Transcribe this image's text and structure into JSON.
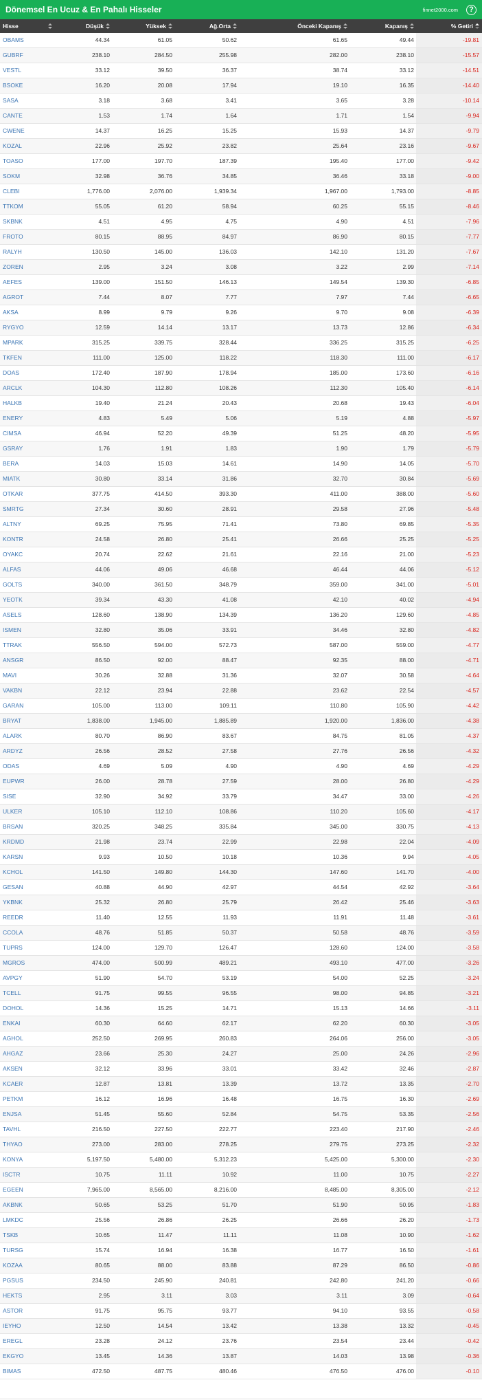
{
  "title": "Dönemsel En Ucuz & En Pahalı Hisseler",
  "site": "finnet2000.com",
  "help_label": "?",
  "columns": {
    "hisse": "Hisse",
    "dusuk": "Düşük",
    "yuksek": "Yüksek",
    "agorta": "Ağ.Orta",
    "onceki": "Önceki Kapanış",
    "kapanis": "Kapanış",
    "getiri": "% Getiri"
  },
  "rows": [
    [
      "OBAMS",
      "44.34",
      "61.05",
      "50.62",
      "61.65",
      "49.44",
      "-19.81"
    ],
    [
      "GUBRF",
      "238.10",
      "284.50",
      "255.98",
      "282.00",
      "238.10",
      "-15.57"
    ],
    [
      "VESTL",
      "33.12",
      "39.50",
      "36.37",
      "38.74",
      "33.12",
      "-14.51"
    ],
    [
      "BSOKE",
      "16.20",
      "20.08",
      "17.94",
      "19.10",
      "16.35",
      "-14.40"
    ],
    [
      "SASA",
      "3.18",
      "3.68",
      "3.41",
      "3.65",
      "3.28",
      "-10.14"
    ],
    [
      "CANTE",
      "1.53",
      "1.74",
      "1.64",
      "1.71",
      "1.54",
      "-9.94"
    ],
    [
      "CWENE",
      "14.37",
      "16.25",
      "15.25",
      "15.93",
      "14.37",
      "-9.79"
    ],
    [
      "KOZAL",
      "22.96",
      "25.92",
      "23.82",
      "25.64",
      "23.16",
      "-9.67"
    ],
    [
      "TOASO",
      "177.00",
      "197.70",
      "187.39",
      "195.40",
      "177.00",
      "-9.42"
    ],
    [
      "SOKM",
      "32.98",
      "36.76",
      "34.85",
      "36.46",
      "33.18",
      "-9.00"
    ],
    [
      "CLEBI",
      "1,776.00",
      "2,076.00",
      "1,939.34",
      "1,967.00",
      "1,793.00",
      "-8.85"
    ],
    [
      "TTKOM",
      "55.05",
      "61.20",
      "58.94",
      "60.25",
      "55.15",
      "-8.46"
    ],
    [
      "SKBNK",
      "4.51",
      "4.95",
      "4.75",
      "4.90",
      "4.51",
      "-7.96"
    ],
    [
      "FROTO",
      "80.15",
      "88.95",
      "84.97",
      "86.90",
      "80.15",
      "-7.77"
    ],
    [
      "RALYH",
      "130.50",
      "145.00",
      "136.03",
      "142.10",
      "131.20",
      "-7.67"
    ],
    [
      "ZOREN",
      "2.95",
      "3.24",
      "3.08",
      "3.22",
      "2.99",
      "-7.14"
    ],
    [
      "AEFES",
      "139.00",
      "151.50",
      "146.13",
      "149.54",
      "139.30",
      "-6.85"
    ],
    [
      "AGROT",
      "7.44",
      "8.07",
      "7.77",
      "7.97",
      "7.44",
      "-6.65"
    ],
    [
      "AKSA",
      "8.99",
      "9.79",
      "9.26",
      "9.70",
      "9.08",
      "-6.39"
    ],
    [
      "RYGYO",
      "12.59",
      "14.14",
      "13.17",
      "13.73",
      "12.86",
      "-6.34"
    ],
    [
      "MPARK",
      "315.25",
      "339.75",
      "328.44",
      "336.25",
      "315.25",
      "-6.25"
    ],
    [
      "TKFEN",
      "111.00",
      "125.00",
      "118.22",
      "118.30",
      "111.00",
      "-6.17"
    ],
    [
      "DOAS",
      "172.40",
      "187.90",
      "178.94",
      "185.00",
      "173.60",
      "-6.16"
    ],
    [
      "ARCLK",
      "104.30",
      "112.80",
      "108.26",
      "112.30",
      "105.40",
      "-6.14"
    ],
    [
      "HALKB",
      "19.40",
      "21.24",
      "20.43",
      "20.68",
      "19.43",
      "-6.04"
    ],
    [
      "ENERY",
      "4.83",
      "5.49",
      "5.06",
      "5.19",
      "4.88",
      "-5.97"
    ],
    [
      "CIMSA",
      "46.94",
      "52.20",
      "49.39",
      "51.25",
      "48.20",
      "-5.95"
    ],
    [
      "GSRAY",
      "1.76",
      "1.91",
      "1.83",
      "1.90",
      "1.79",
      "-5.79"
    ],
    [
      "BERA",
      "14.03",
      "15.03",
      "14.61",
      "14.90",
      "14.05",
      "-5.70"
    ],
    [
      "MIATK",
      "30.80",
      "33.14",
      "31.86",
      "32.70",
      "30.84",
      "-5.69"
    ],
    [
      "OTKAR",
      "377.75",
      "414.50",
      "393.30",
      "411.00",
      "388.00",
      "-5.60"
    ],
    [
      "SMRTG",
      "27.34",
      "30.60",
      "28.91",
      "29.58",
      "27.96",
      "-5.48"
    ],
    [
      "ALTNY",
      "69.25",
      "75.95",
      "71.41",
      "73.80",
      "69.85",
      "-5.35"
    ],
    [
      "KONTR",
      "24.58",
      "26.80",
      "25.41",
      "26.66",
      "25.25",
      "-5.25"
    ],
    [
      "OYAKC",
      "20.74",
      "22.62",
      "21.61",
      "22.16",
      "21.00",
      "-5.23"
    ],
    [
      "ALFAS",
      "44.06",
      "49.06",
      "46.68",
      "46.44",
      "44.06",
      "-5.12"
    ],
    [
      "GOLTS",
      "340.00",
      "361.50",
      "348.79",
      "359.00",
      "341.00",
      "-5.01"
    ],
    [
      "YEOTK",
      "39.34",
      "43.30",
      "41.08",
      "42.10",
      "40.02",
      "-4.94"
    ],
    [
      "ASELS",
      "128.60",
      "138.90",
      "134.39",
      "136.20",
      "129.60",
      "-4.85"
    ],
    [
      "ISMEN",
      "32.80",
      "35.06",
      "33.91",
      "34.46",
      "32.80",
      "-4.82"
    ],
    [
      "TTRAK",
      "556.50",
      "594.00",
      "572.73",
      "587.00",
      "559.00",
      "-4.77"
    ],
    [
      "ANSGR",
      "86.50",
      "92.00",
      "88.47",
      "92.35",
      "88.00",
      "-4.71"
    ],
    [
      "MAVI",
      "30.26",
      "32.88",
      "31.36",
      "32.07",
      "30.58",
      "-4.64"
    ],
    [
      "VAKBN",
      "22.12",
      "23.94",
      "22.88",
      "23.62",
      "22.54",
      "-4.57"
    ],
    [
      "GARAN",
      "105.00",
      "113.00",
      "109.11",
      "110.80",
      "105.90",
      "-4.42"
    ],
    [
      "BRYAT",
      "1,838.00",
      "1,945.00",
      "1,885.89",
      "1,920.00",
      "1,836.00",
      "-4.38"
    ],
    [
      "ALARK",
      "80.70",
      "86.90",
      "83.67",
      "84.75",
      "81.05",
      "-4.37"
    ],
    [
      "ARDYZ",
      "26.56",
      "28.52",
      "27.58",
      "27.76",
      "26.56",
      "-4.32"
    ],
    [
      "ODAS",
      "4.69",
      "5.09",
      "4.90",
      "4.90",
      "4.69",
      "-4.29"
    ],
    [
      "EUPWR",
      "26.00",
      "28.78",
      "27.59",
      "28.00",
      "26.80",
      "-4.29"
    ],
    [
      "SISE",
      "32.90",
      "34.92",
      "33.79",
      "34.47",
      "33.00",
      "-4.26"
    ],
    [
      "ULKER",
      "105.10",
      "112.10",
      "108.86",
      "110.20",
      "105.60",
      "-4.17"
    ],
    [
      "BRSAN",
      "320.25",
      "348.25",
      "335.84",
      "345.00",
      "330.75",
      "-4.13"
    ],
    [
      "KRDMD",
      "21.98",
      "23.74",
      "22.99",
      "22.98",
      "22.04",
      "-4.09"
    ],
    [
      "KARSN",
      "9.93",
      "10.50",
      "10.18",
      "10.36",
      "9.94",
      "-4.05"
    ],
    [
      "KCHOL",
      "141.50",
      "149.80",
      "144.30",
      "147.60",
      "141.70",
      "-4.00"
    ],
    [
      "GESAN",
      "40.88",
      "44.90",
      "42.97",
      "44.54",
      "42.92",
      "-3.64"
    ],
    [
      "YKBNK",
      "25.32",
      "26.80",
      "25.79",
      "26.42",
      "25.46",
      "-3.63"
    ],
    [
      "REEDR",
      "11.40",
      "12.55",
      "11.93",
      "11.91",
      "11.48",
      "-3.61"
    ],
    [
      "CCOLA",
      "48.76",
      "51.85",
      "50.37",
      "50.58",
      "48.76",
      "-3.59"
    ],
    [
      "TUPRS",
      "124.00",
      "129.70",
      "126.47",
      "128.60",
      "124.00",
      "-3.58"
    ],
    [
      "MGROS",
      "474.00",
      "500.99",
      "489.21",
      "493.10",
      "477.00",
      "-3.26"
    ],
    [
      "AVPGY",
      "51.90",
      "54.70",
      "53.19",
      "54.00",
      "52.25",
      "-3.24"
    ],
    [
      "TCELL",
      "91.75",
      "99.55",
      "96.55",
      "98.00",
      "94.85",
      "-3.21"
    ],
    [
      "DOHOL",
      "14.36",
      "15.25",
      "14.71",
      "15.13",
      "14.66",
      "-3.11"
    ],
    [
      "ENKAI",
      "60.30",
      "64.60",
      "62.17",
      "62.20",
      "60.30",
      "-3.05"
    ],
    [
      "AGHOL",
      "252.50",
      "269.95",
      "260.83",
      "264.06",
      "256.00",
      "-3.05"
    ],
    [
      "AHGAZ",
      "23.66",
      "25.30",
      "24.27",
      "25.00",
      "24.26",
      "-2.96"
    ],
    [
      "AKSEN",
      "32.12",
      "33.96",
      "33.01",
      "33.42",
      "32.46",
      "-2.87"
    ],
    [
      "KCAER",
      "12.87",
      "13.81",
      "13.39",
      "13.72",
      "13.35",
      "-2.70"
    ],
    [
      "PETKM",
      "16.12",
      "16.96",
      "16.48",
      "16.75",
      "16.30",
      "-2.69"
    ],
    [
      "ENJSA",
      "51.45",
      "55.60",
      "52.84",
      "54.75",
      "53.35",
      "-2.56"
    ],
    [
      "TAVHL",
      "216.50",
      "227.50",
      "222.77",
      "223.40",
      "217.90",
      "-2.46"
    ],
    [
      "THYAO",
      "273.00",
      "283.00",
      "278.25",
      "279.75",
      "273.25",
      "-2.32"
    ],
    [
      "KONYA",
      "5,197.50",
      "5,480.00",
      "5,312.23",
      "5,425.00",
      "5,300.00",
      "-2.30"
    ],
    [
      "ISCTR",
      "10.75",
      "11.11",
      "10.92",
      "11.00",
      "10.75",
      "-2.27"
    ],
    [
      "EGEEN",
      "7,965.00",
      "8,565.00",
      "8,216.00",
      "8,485.00",
      "8,305.00",
      "-2.12"
    ],
    [
      "AKBNK",
      "50.65",
      "53.25",
      "51.70",
      "51.90",
      "50.95",
      "-1.83"
    ],
    [
      "LMKDC",
      "25.56",
      "26.86",
      "26.25",
      "26.66",
      "26.20",
      "-1.73"
    ],
    [
      "TSKB",
      "10.65",
      "11.47",
      "11.11",
      "11.08",
      "10.90",
      "-1.62"
    ],
    [
      "TURSG",
      "15.74",
      "16.94",
      "16.38",
      "16.77",
      "16.50",
      "-1.61"
    ],
    [
      "KOZAA",
      "80.65",
      "88.00",
      "83.88",
      "87.29",
      "86.50",
      "-0.86"
    ],
    [
      "PGSUS",
      "234.50",
      "245.90",
      "240.81",
      "242.80",
      "241.20",
      "-0.66"
    ],
    [
      "HEKTS",
      "2.95",
      "3.11",
      "3.03",
      "3.11",
      "3.09",
      "-0.64"
    ],
    [
      "ASTOR",
      "91.75",
      "95.75",
      "93.77",
      "94.10",
      "93.55",
      "-0.58"
    ],
    [
      "IEYHO",
      "12.50",
      "14.54",
      "13.42",
      "13.38",
      "13.32",
      "-0.45"
    ],
    [
      "EREGL",
      "23.28",
      "24.12",
      "23.76",
      "23.54",
      "23.44",
      "-0.42"
    ],
    [
      "EKGYO",
      "13.45",
      "14.36",
      "13.87",
      "14.03",
      "13.98",
      "-0.36"
    ],
    [
      "BIMAS",
      "472.50",
      "487.75",
      "480.46",
      "476.50",
      "476.00",
      "-0.10"
    ]
  ]
}
